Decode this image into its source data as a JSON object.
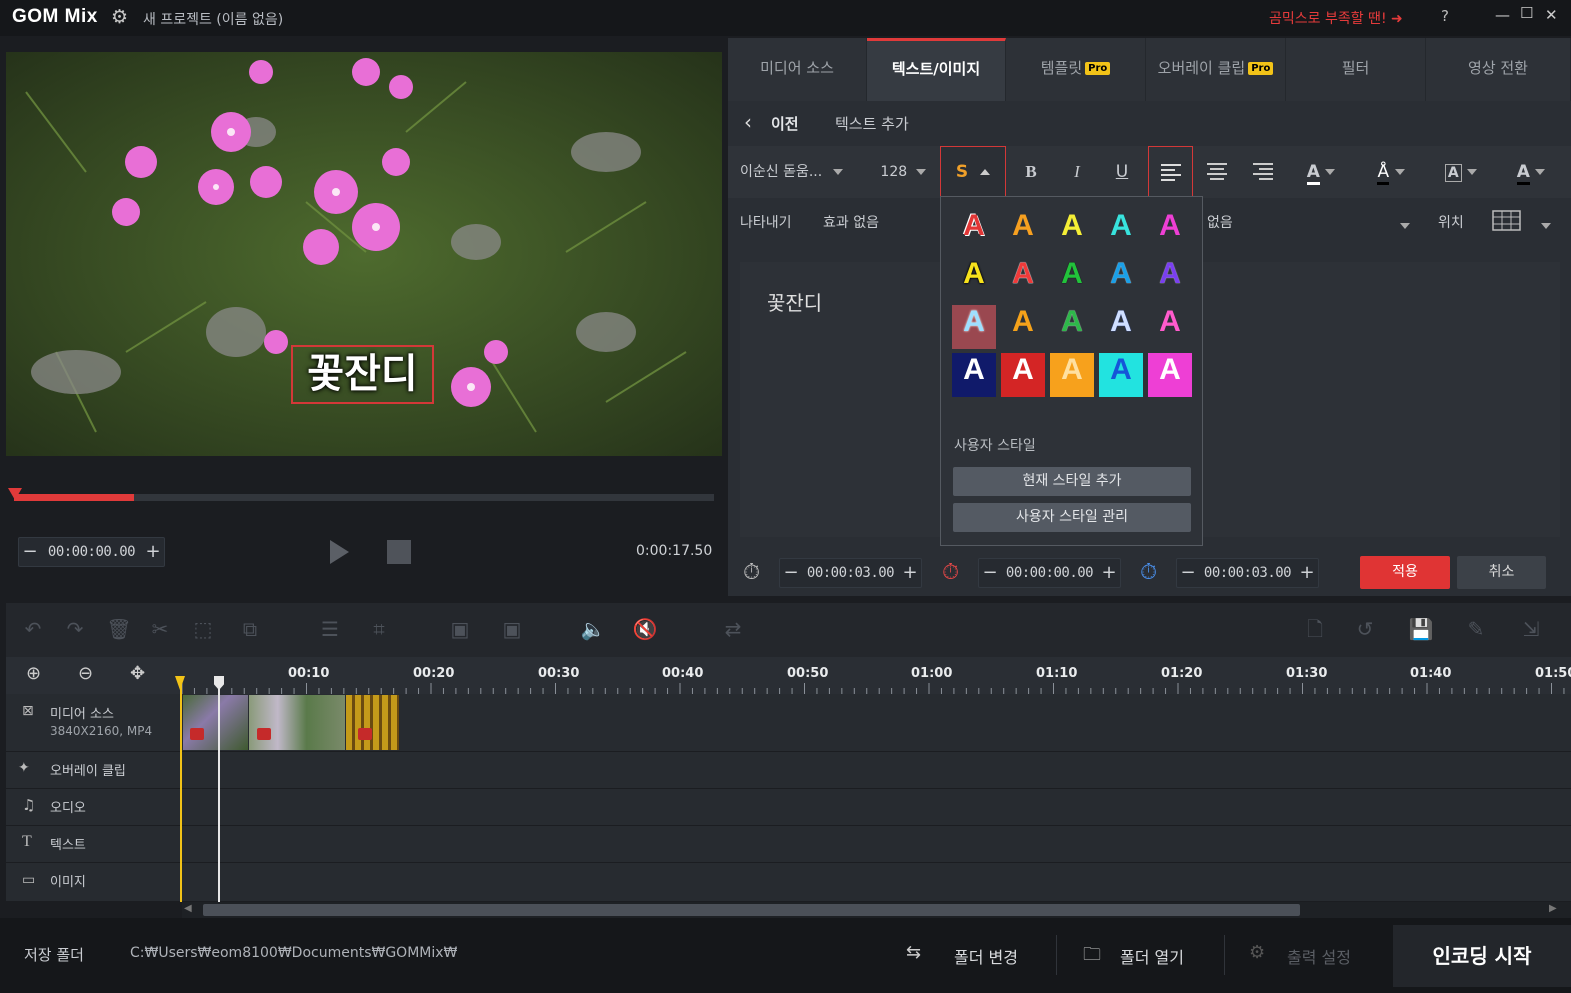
{
  "titlebar": {
    "logo": "GOM Mix",
    "project": "새 프로젝트 (이름 없음)",
    "promo": "곰믹스로 부족할 땐! ➜",
    "help": "?"
  },
  "preview": {
    "overlay_text": "꽃잔디",
    "current_time": "00:00:00.00",
    "duration": "0:00:17.50"
  },
  "tabs": [
    {
      "label": "미디어 소스",
      "pro": false
    },
    {
      "label": "텍스트/이미지",
      "pro": true,
      "active": true
    },
    {
      "label": "템플릿",
      "pro": true
    },
    {
      "label": "오버레이 클립",
      "pro": true
    },
    {
      "label": "필터",
      "pro": false
    },
    {
      "label": "영상 전환",
      "pro": false
    }
  ],
  "pro_badge": "Pro",
  "subbar": {
    "back": "이전",
    "title": "텍스트 추가"
  },
  "format": {
    "font": "이순신 돋움...",
    "size": "128",
    "style_btn": "S",
    "bold": "B",
    "italic": "I",
    "underline": "U"
  },
  "effects": {
    "appear_label": "나타내기",
    "appear_value": "효과 없음",
    "disappear_value": "없음",
    "position_label": "위치"
  },
  "text_content": "꽃잔디",
  "style_popup": {
    "swatch_letter": "A",
    "user_style_label": "사용자 스타일",
    "add_button": "현재 스타일 추가",
    "manage_button": "사용자 스타일 관리"
  },
  "timing": {
    "duration": "00:00:03.00",
    "start": "00:00:00.00",
    "end": "00:00:03.00"
  },
  "actions": {
    "apply": "적용",
    "cancel": "취소"
  },
  "timeline": {
    "ruler": [
      "00:10",
      "00:20",
      "00:30",
      "00:40",
      "00:50",
      "01:00",
      "01:10",
      "01:20",
      "01:30",
      "01:40",
      "01:50"
    ],
    "tracks": {
      "media": "미디어 소스",
      "media_info": "3840X2160, MP4",
      "overlay": "오버레이 클립",
      "audio": "오디오",
      "text": "텍스트",
      "image": "이미지"
    }
  },
  "bottom": {
    "save_folder_label": "저장 폴더",
    "path": "C:₩Users₩eom8100₩Documents₩GOMMix₩",
    "change_folder": "폴더 변경",
    "open_folder": "폴더 열기",
    "output_settings": "출력 설정",
    "encode": "인코딩 시작"
  }
}
